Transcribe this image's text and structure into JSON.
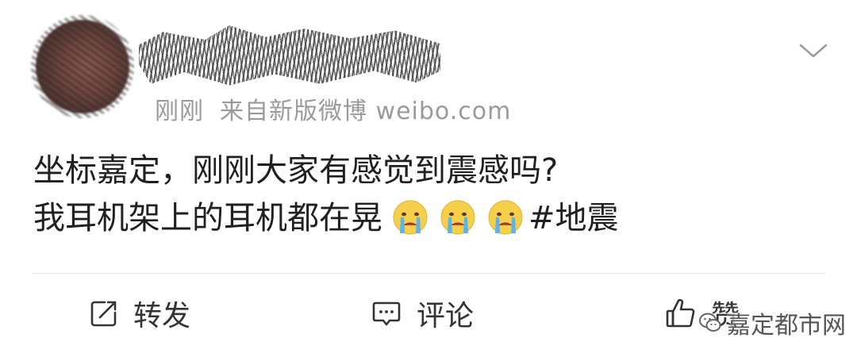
{
  "post": {
    "meta": {
      "time": "刚刚",
      "source": "来自新版微博 weibo.com"
    },
    "text_line1": "坐标嘉定，刚刚大家有感觉到震感吗?",
    "text_line2_prefix": "我耳机架上的耳机都在晃",
    "emojis": [
      "crying-face-emoji",
      "crying-face-emoji",
      "crying-face-emoji"
    ],
    "hashtag": "#地震",
    "actions": {
      "repost": "转发",
      "comment": "评论",
      "like": "赞"
    }
  },
  "watermark": {
    "text": "嘉定都市网"
  },
  "icons": {
    "more": "chevron-down-icon",
    "repost": "repost-icon",
    "comment": "comment-icon",
    "like": "thumbs-up-icon",
    "watermark": "wechat-icon"
  },
  "colors": {
    "text": "#202020",
    "meta": "#9a9a9a",
    "divider": "#e6e6e6"
  }
}
